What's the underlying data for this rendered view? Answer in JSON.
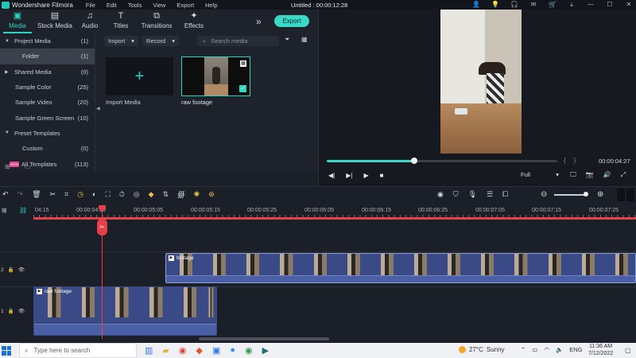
{
  "titlebar": {
    "app_name": "Wondershare Filmora",
    "menu": [
      "File",
      "Edit",
      "Tools",
      "View",
      "Export",
      "Help"
    ],
    "document_title": "Untitled : 00:00:12:28",
    "window_icons": [
      "user-icon",
      "bulb-icon",
      "headset-icon",
      "message-icon",
      "cart-icon",
      "download-icon",
      "minimize-icon",
      "maximize-icon",
      "close-icon"
    ]
  },
  "media_toolbar": {
    "tabs": [
      {
        "label": "Media",
        "icon": "folder-icon",
        "active": true
      },
      {
        "label": "Stock Media",
        "icon": "image-icon",
        "active": false
      },
      {
        "label": "Audio",
        "icon": "music-icon",
        "active": false
      },
      {
        "label": "Titles",
        "icon": "text-icon",
        "active": false
      },
      {
        "label": "Transitions",
        "icon": "transition-icon",
        "active": false
      },
      {
        "label": "Effects",
        "icon": "effects-icon",
        "active": false
      }
    ],
    "more_label": "»",
    "export_label": "Export"
  },
  "tree": {
    "items": [
      {
        "label": "Project Media",
        "count": "(1)",
        "expanded": true
      },
      {
        "label": "Folder",
        "count": "(1)",
        "selected": true
      },
      {
        "label": "Shared Media",
        "count": "(0)"
      },
      {
        "label": "Sample Color",
        "count": "(25)"
      },
      {
        "label": "Sample Video",
        "count": "(20)"
      },
      {
        "label": "Sample Green Screen",
        "count": "(10)"
      },
      {
        "label": "Preset Templates",
        "count": ""
      },
      {
        "label": "Custom",
        "count": "(0)"
      },
      {
        "label": "All Templates",
        "count": "(113)",
        "badge": "NEW"
      }
    ]
  },
  "browser": {
    "import_dropdown": "Import",
    "record_dropdown": "Record",
    "search_placeholder": "Search media",
    "import_tile_label": "Import Media",
    "clip_label": "raw footage"
  },
  "preview": {
    "progress_fraction": 0.38,
    "timecode": "00:00:04:27",
    "quality": "Full",
    "brace_left": "{",
    "brace_right": "}"
  },
  "ruler": {
    "labels": [
      "04:15",
      "00:00:04:25",
      "00:00:05:05",
      "00:00:05:15",
      "00:00:05:25",
      "00:00:06:05",
      "00:00:06:15",
      "00:00:06:25",
      "00:00:07:05",
      "00:00:07:15",
      "00:00:07:25"
    ]
  },
  "tracks": {
    "track2": {
      "number": "2",
      "clip_label": "footage"
    },
    "track1": {
      "number": "1",
      "clip_label": "raw footage"
    }
  },
  "taskbar": {
    "search_placeholder": "Type here to search",
    "weather_temp": "27°C",
    "weather_text": "Sunny",
    "language": "ENG",
    "time": "11:36 AM",
    "date": "7/12/2022"
  },
  "colors": {
    "accent": "#2fd3c1",
    "playhead": "#e8404a",
    "clip": "#3a4a87"
  }
}
